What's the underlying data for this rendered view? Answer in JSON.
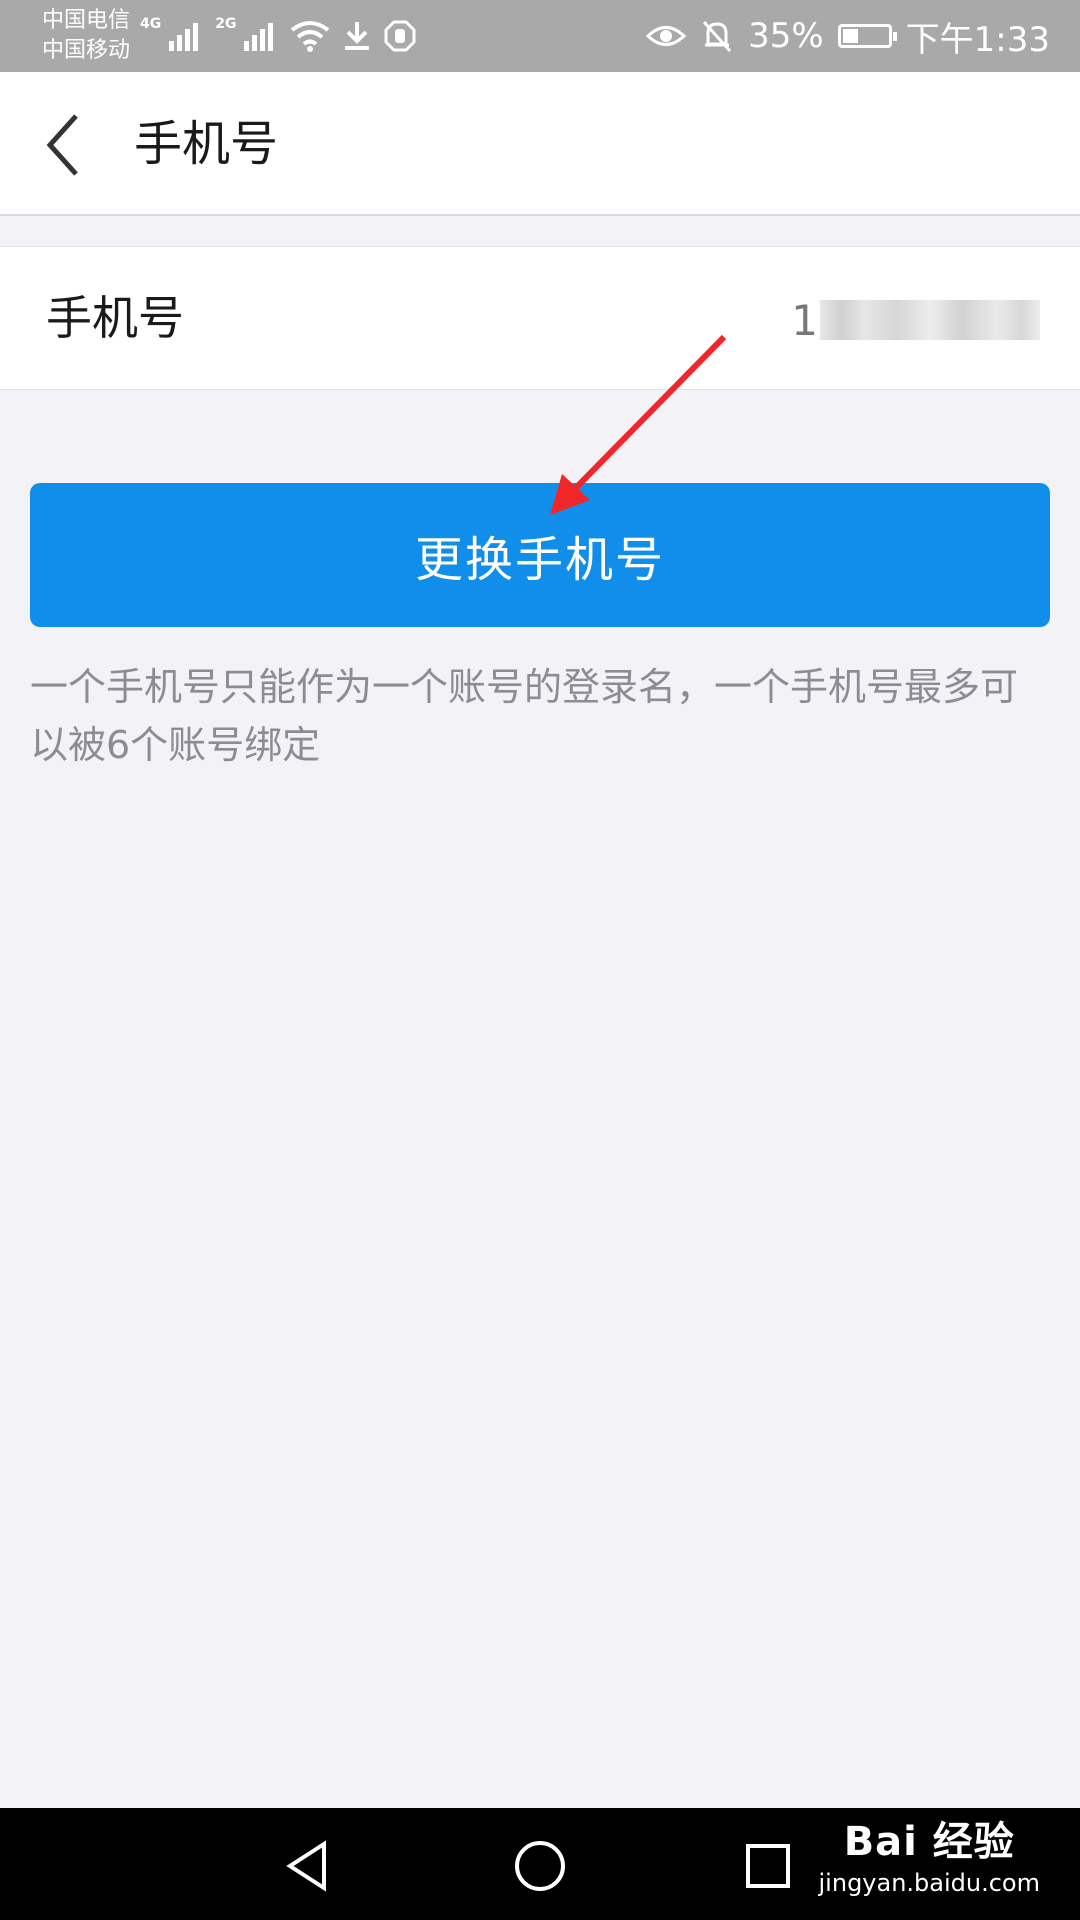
{
  "status_bar": {
    "carrier_1": "中国电信",
    "carrier_2": "中国移动",
    "net_1": "4G",
    "net_2": "2G",
    "battery": "35%",
    "battery_level": 0.35,
    "time": "下午1:33"
  },
  "header": {
    "title": "手机号"
  },
  "phone_row": {
    "label": "手机号",
    "value_visible": "1"
  },
  "actions": {
    "change_phone_label": "更换手机号"
  },
  "note": {
    "text": "一个手机号只能作为一个账号的登录名，一个手机号最多可以被6个账号绑定"
  },
  "watermark": {
    "logo": "Bai 经验",
    "url": "jingyan.baidu.com"
  },
  "colors": {
    "accent": "#118ee9",
    "annotation_arrow": "#f0262a"
  }
}
